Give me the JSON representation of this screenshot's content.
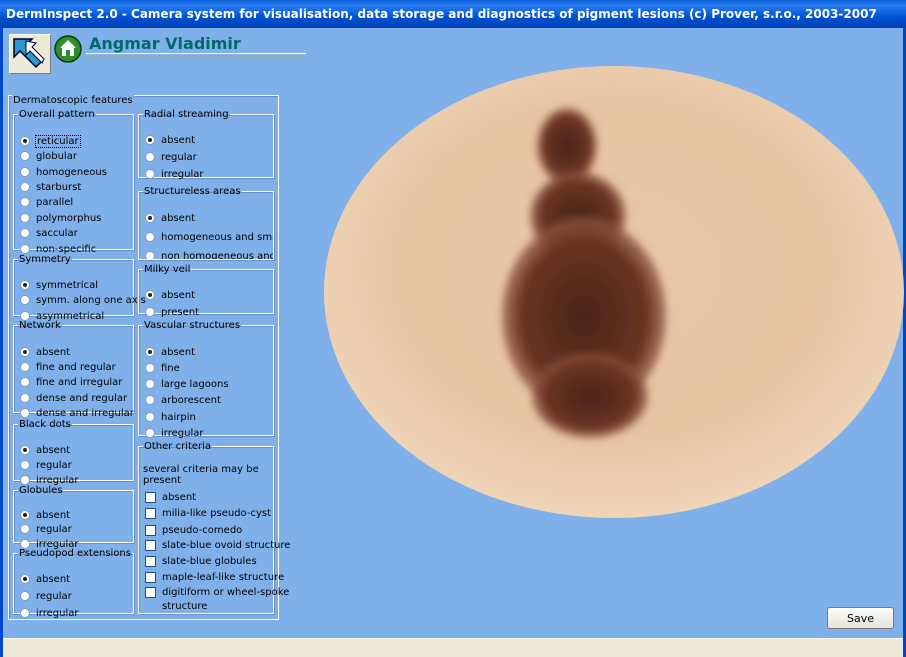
{
  "window": {
    "title": "DermInspect 2.0 - Camera system for visualisation, data storage and diagnostics of pigment lesions (c) Prover, s.r.o., 2003-2007"
  },
  "header": {
    "patient_name": "Angmar Vladimir",
    "back_icon": "back-arrow-icon",
    "home_icon": "home-icon"
  },
  "panel": {
    "title": "Dermatoscopic features"
  },
  "groups": {
    "overall_pattern": {
      "title": "Overall pattern",
      "options": [
        "reticular",
        "globular",
        "homogeneous",
        "starburst",
        "parallel",
        "polymorphus",
        "saccular",
        "non-specific"
      ],
      "selected": "reticular"
    },
    "symmetry": {
      "title": "Symmetry",
      "options": [
        "symmetrical",
        "symm. along one axis",
        "asymmetrical"
      ],
      "selected": "symmetrical"
    },
    "network": {
      "title": "Network",
      "options": [
        "absent",
        "fine and regular",
        "fine and irregular",
        "dense and regular",
        "dense and irregular"
      ],
      "selected": "absent"
    },
    "black_dots": {
      "title": "Black dots",
      "options": [
        "absent",
        "regular",
        "irregular"
      ],
      "selected": "absent"
    },
    "globules": {
      "title": "Globules",
      "options": [
        "absent",
        "regular",
        "irregular"
      ],
      "selected": "absent"
    },
    "pseudopod": {
      "title": "Pseudopod extensions",
      "options": [
        "absent",
        "regular",
        "irregular"
      ],
      "selected": "absent"
    },
    "radial_streaming": {
      "title": "Radial streaming",
      "options": [
        "absent",
        "regular",
        "irregular"
      ],
      "selected": "absent"
    },
    "structureless": {
      "title": "Structureless areas",
      "options": [
        "absent",
        "homogeneous and small",
        "non homogeneous and wic"
      ],
      "selected": "absent"
    },
    "milky_veil": {
      "title": "Milky veil",
      "options": [
        "absent",
        "present"
      ],
      "selected": "absent"
    },
    "vascular": {
      "title": "Vascular structures",
      "options": [
        "absent",
        "fine",
        "large lagoons",
        "arborescent",
        "hairpin",
        "irregular"
      ],
      "selected": "absent"
    },
    "other": {
      "title": "Other criteria",
      "note": "several criteria may be present",
      "options": [
        "absent",
        "milia-like pseudo-cyst",
        "pseudo-comedo",
        "slate-blue ovoid structure",
        "slate-blue globules",
        "maple-leaf-like structure",
        "digitiform or wheel-spoke",
        "structure"
      ]
    }
  },
  "actions": {
    "save_label": "Save"
  },
  "colors": {
    "background": "#7fb0ea",
    "titlebar": "#0053d4",
    "patient_name": "#006b6b"
  }
}
